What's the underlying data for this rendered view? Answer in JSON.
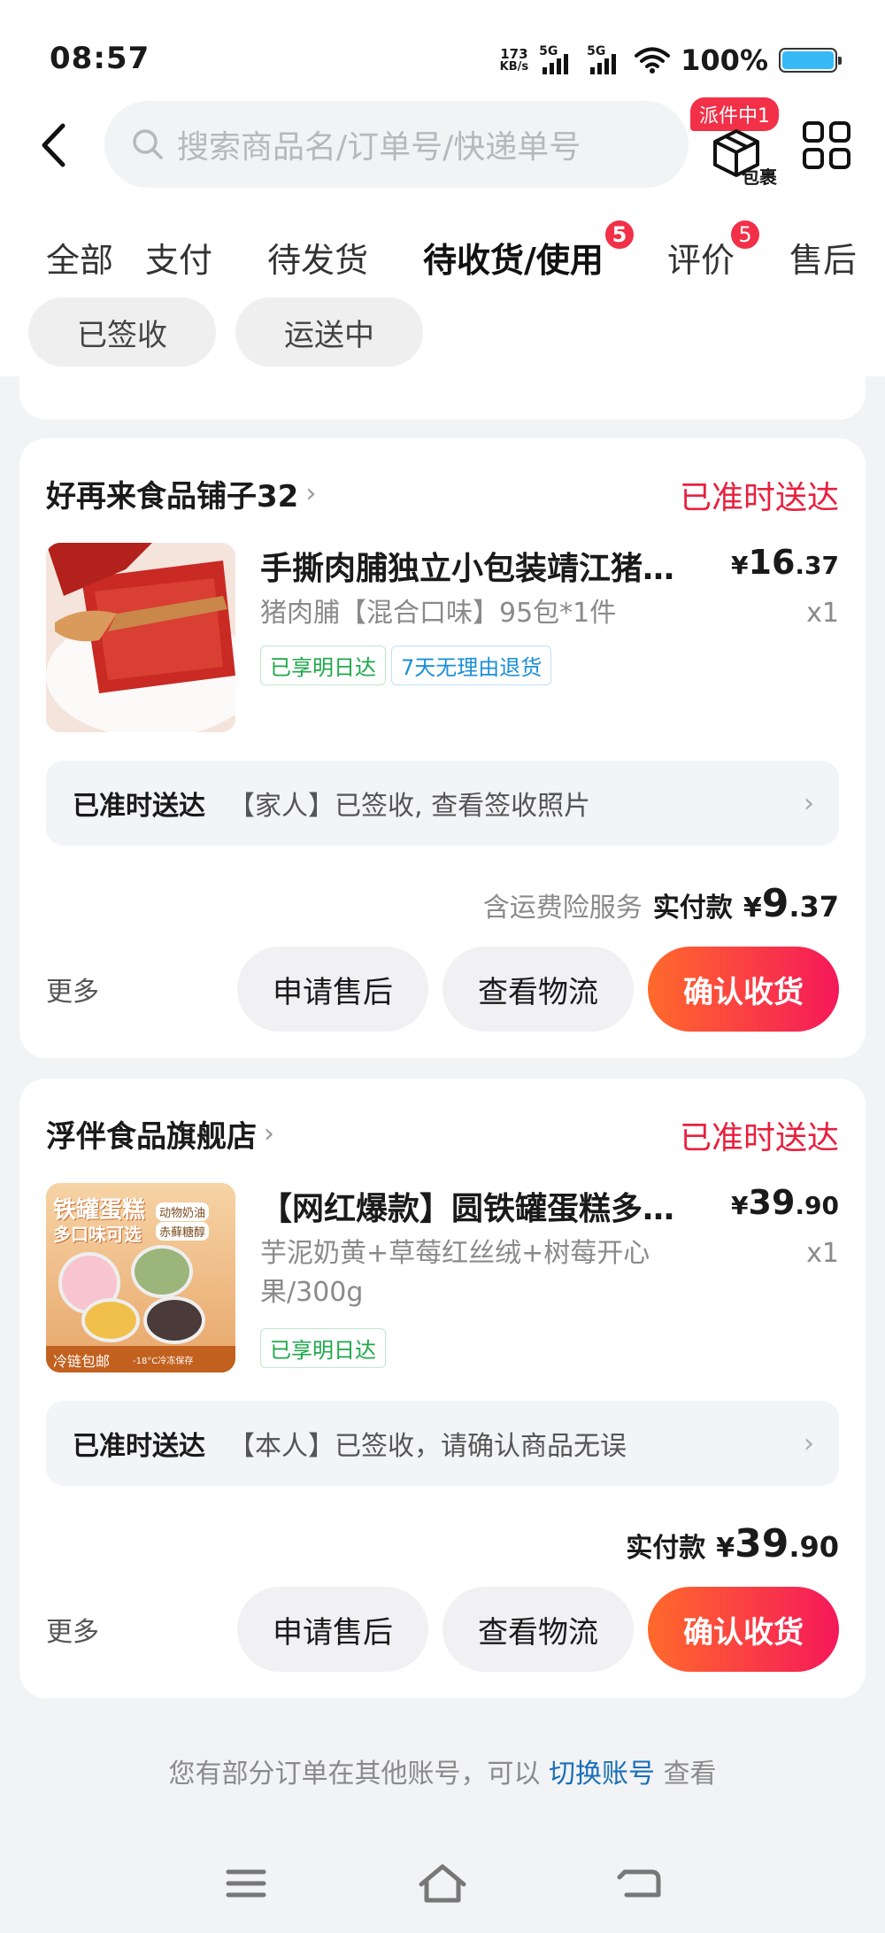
{
  "status_bar": {
    "time": "08:57",
    "net_speed_value": "173",
    "net_speed_unit": "KB/s",
    "signal1_label": "5G",
    "signal2_label": "5G",
    "battery_pct": "100%"
  },
  "header": {
    "search_placeholder": "搜索商品名/订单号/快递单号",
    "package_badge": "派件中1",
    "package_label": "包裹"
  },
  "tabs": [
    {
      "label": "全部"
    },
    {
      "label": "支付"
    },
    {
      "label": "待发货"
    },
    {
      "label": "待收货/使用",
      "badge": "5",
      "active": true
    },
    {
      "label": "评价",
      "badge": "5"
    },
    {
      "label": "售后"
    }
  ],
  "chips": [
    {
      "label": "已签收"
    },
    {
      "label": "运送中"
    }
  ],
  "orders": [
    {
      "shop": "好再来食品铺子32",
      "status": "已准时送达",
      "title": "手撕肉脯独立小包装靖江猪肉脯",
      "spec": "猪肉脯【混合口味】95包*1件",
      "price_sym": "¥",
      "price_int": "16",
      "price_dec": ".37",
      "qty": "x1",
      "tags": [
        "已享明日达",
        "7天无理由退货"
      ],
      "track_lead": "已准时送达",
      "track_text": "【家人】已签收, 查看签收照片",
      "insurance": "含运费险服务",
      "paid_label": "实付款",
      "paid_sym": "¥",
      "paid_int": "9",
      "paid_dec": ".37",
      "more": "更多",
      "btn_aftersale": "申请售后",
      "btn_logistics": "查看物流",
      "btn_confirm": "确认收货"
    },
    {
      "shop": "浮伴食品旗舰店",
      "status": "已准时送达",
      "title": "【网红爆款】圆铁罐蛋糕多口味可选",
      "spec": "芋泥奶黄+草莓红丝绒+树莓开心果/300g",
      "price_sym": "¥",
      "price_int": "39",
      "price_dec": ".90",
      "qty": "x1",
      "tags": [
        "已享明日达"
      ],
      "track_lead": "已准时送达",
      "track_text": "【本人】已签收，请确认商品无误",
      "paid_label": "实付款",
      "paid_sym": "¥",
      "paid_int": "39",
      "paid_dec": ".90",
      "more": "更多",
      "btn_aftersale": "申请售后",
      "btn_logistics": "查看物流",
      "btn_confirm": "确认收货",
      "thumb_text": {
        "title": "铁罐蛋糕",
        "subtitle": "多口味可选",
        "badge1": "动物奶油",
        "badge2": "赤藓糖醇",
        "footer": "冷链包邮",
        "footer2": "-18°C冷冻保存"
      }
    }
  ],
  "footer": {
    "note_pre": "您有部分订单在其他账号，可以",
    "note_link": "切换账号",
    "note_post": "查看"
  },
  "colors": {
    "accent_red": "#e8203f",
    "badge_red": "#f23048",
    "primary_gradient_start": "#ff6a2b",
    "primary_gradient_end": "#f5185a",
    "tag_green": "#1ea84a",
    "tag_blue": "#1a8fd8",
    "link_blue": "#1a6fb8"
  },
  "icons": {
    "back": "chevron-left-icon",
    "search": "search-icon",
    "package": "package-box-icon",
    "grid": "grid-menu-icon",
    "nav_menu": "menu-lines-icon",
    "nav_home": "home-icon",
    "nav_back": "back-arrow-icon"
  }
}
